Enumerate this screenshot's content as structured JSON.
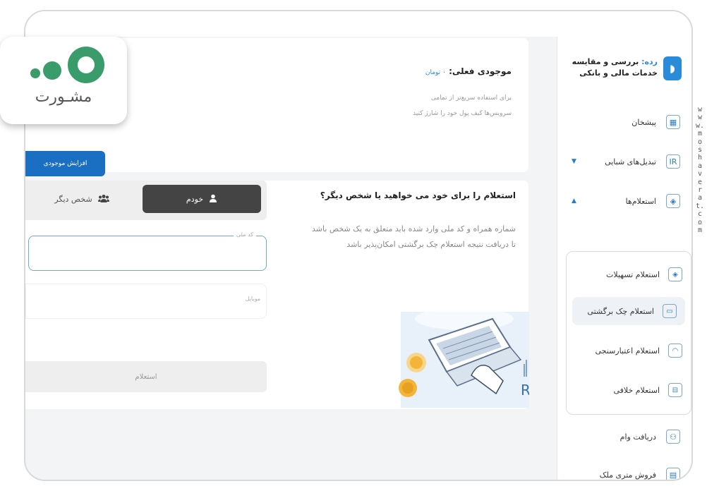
{
  "brand": {
    "prefix": "رده:",
    "line1": "بررسی و مقایسه",
    "line2": "خدمات مالی و بانکی"
  },
  "sidebar": {
    "items": [
      {
        "label": "پیشخان"
      },
      {
        "label": "تبدیل‌های شبایی"
      },
      {
        "label": "استعلام‌ها"
      },
      {
        "label": "دریافت وام"
      },
      {
        "label": "فروش متری ملک"
      }
    ],
    "submenu": [
      {
        "label": "استعلام تسهیلات"
      },
      {
        "label": "استعلام چک برگشتی"
      },
      {
        "label": "استعلام اعتبارسنجی"
      },
      {
        "label": "استعلام خلافی"
      }
    ]
  },
  "balance": {
    "label": "موجودی فعلی:",
    "amount": "۰ تومان"
  },
  "note": {
    "line1": "برای استفاده سریع‌تر از تمامی",
    "line2": "سرویس‌ها کیف پول خود را شارژ کنید"
  },
  "topup_label": "افزایش موجودی",
  "inquiry": {
    "question": "استعلام را برای خود می خواهید یا شخص دیگر؟",
    "desc_line1": "شماره همراه و کد ملی وارد شده باید متعلق به یک شخص باشد",
    "desc_line2": "تا دریافت نتیجه استعلام چک برگشتی امکان‌پذیر باشد",
    "option_self": "خودم",
    "option_other": "شخص دیگر",
    "national_code_label": "کد ملی",
    "mobile_label": "موبایل",
    "submit_label": "استعلام"
  },
  "logo": {
    "text": "مشـورت"
  },
  "watermark": "www.moshaverat.com",
  "illustration_letter": "R",
  "colors": {
    "accent": "#1a6fc2",
    "selected_option": "#444444"
  }
}
